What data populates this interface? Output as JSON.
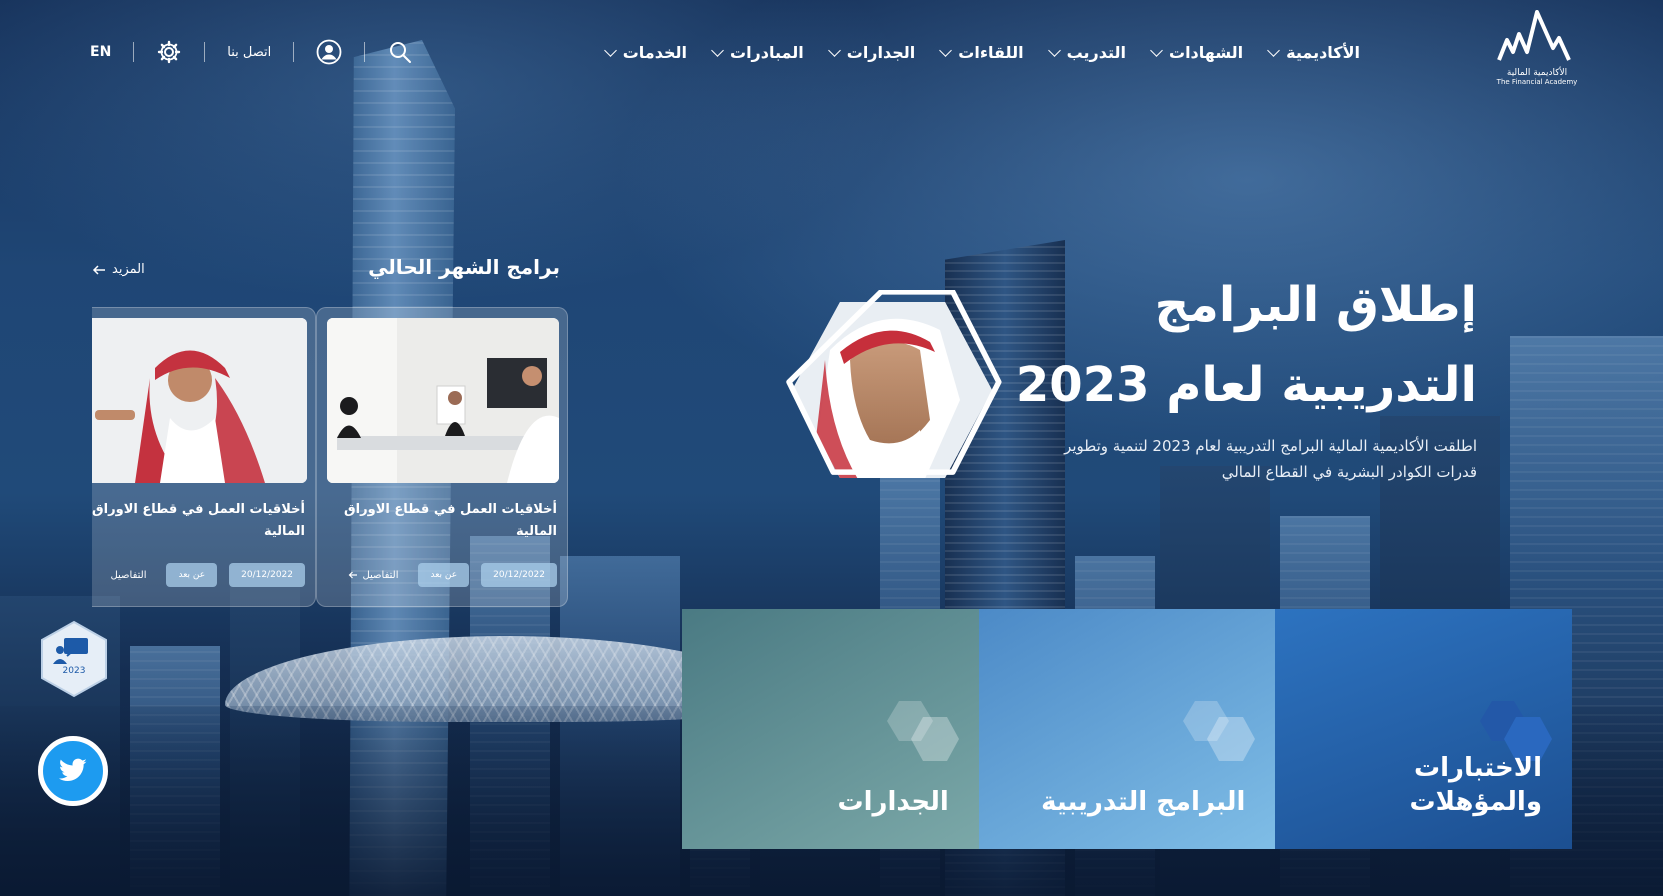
{
  "header": {
    "logo": {
      "name_ar": "الأكاديمية المالية",
      "name_en": "The Financial Academy"
    },
    "nav": [
      {
        "label": "الأكاديمية"
      },
      {
        "label": "الشهادات"
      },
      {
        "label": "التدريب"
      },
      {
        "label": "اللقاءات"
      },
      {
        "label": "الجدارات"
      },
      {
        "label": "المبادرات"
      },
      {
        "label": "الخدمات"
      }
    ],
    "utils": {
      "lang": "EN",
      "contact": "اتصل بنا",
      "icons": [
        "settings-icon",
        "user-icon",
        "search-icon"
      ]
    }
  },
  "hero": {
    "title_line1": "إطلاق البرامج",
    "title_line2": "التدريبية لعام 2023",
    "description": "اطلقت الأكاديمية المالية البرامج التدريبية لعام 2023 لتنمية وتطوير قدرات الكوادر البشرية في القطاع المالي"
  },
  "programs": {
    "title": "برامج الشهر الحالي",
    "more": "المزيد",
    "cards": [
      {
        "title": "أخلاقيات العمل في قطاع الاوراق المالية",
        "date": "20/12/2022",
        "mode": "عن بعد",
        "details": "التفاصيل"
      },
      {
        "title": "أخلاقيات العمل في قطاع الاوراق المالية",
        "date": "20/12/2022",
        "mode": "عن بعد",
        "details": "التفاصيل"
      }
    ]
  },
  "tiles": [
    {
      "label_line1": "الاختبارات",
      "label_line2": "والمؤهلات"
    },
    {
      "label_line1": "البرامج التدريبية",
      "label_line2": ""
    },
    {
      "label_line1": "الجدارات",
      "label_line2": ""
    }
  ],
  "widgets": {
    "badge_year": "2023",
    "social": "twitter-icon"
  },
  "colors": {
    "tile_1": "#1c4f91",
    "tile_2": "#7fbde6",
    "tile_3": "#7ba8a8",
    "twitter": "#1d9bf0"
  }
}
